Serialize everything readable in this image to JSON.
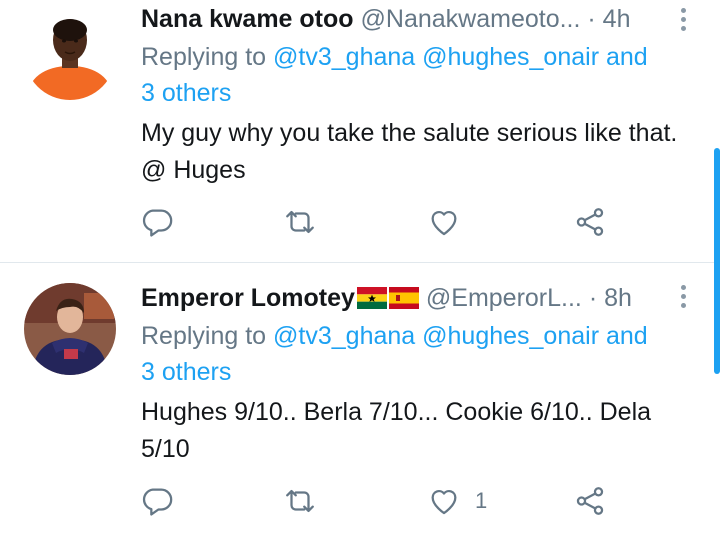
{
  "tweets": [
    {
      "name": "Nana kwame otoo",
      "handle": "@Nanakwameoto...",
      "time": "4h",
      "replying_prefix": "Replying to",
      "replying_links": "@tv3_ghana @hughes_onair and",
      "replying_links_2": "3 others",
      "text": "My guy why you take the salute serious like that. @ Huges",
      "like_count": ""
    },
    {
      "name": "Emperor Lomotey",
      "handle": "@EmperorL...",
      "time": "8h",
      "replying_prefix": "Replying to",
      "replying_links": "@tv3_ghana @hughes_onair and",
      "replying_links_2": "3 others",
      "text": "Hughes 9/10.. Berla 7/10... Cookie 6/10.. Dela 5/10",
      "like_count": "1"
    }
  ],
  "separator": "·",
  "colors": {
    "accent": "#1da1f2",
    "secondary_text": "#657786",
    "primary_text": "#14171a",
    "divider": "#e1e8ed"
  },
  "icons": [
    "reply-icon",
    "retweet-icon",
    "like-icon",
    "share-icon",
    "more-icon",
    "ghana-flag",
    "spain-flag"
  ]
}
